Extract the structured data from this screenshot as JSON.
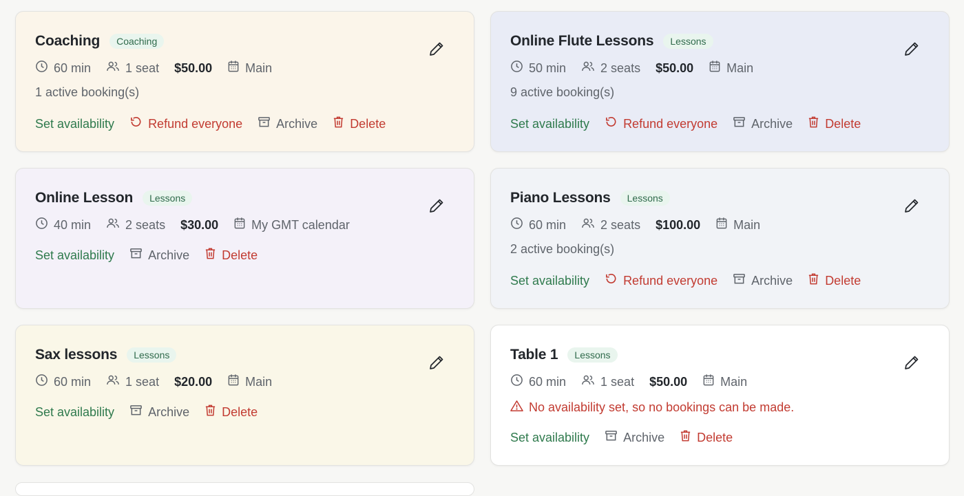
{
  "colors": {
    "page_bg": "#f7f7f5",
    "accent_green": "#2f7a4d",
    "danger_red": "#c23b31",
    "muted": "#5f646b"
  },
  "cards": [
    {
      "title": "Coaching",
      "badge": "Coaching",
      "bg": "#fbf5ea",
      "duration": "60 min",
      "seats": "1 seat",
      "price": "$50.00",
      "calendar": "Main",
      "status": "1 active booking(s)",
      "actions": {
        "availability": "Set availability",
        "refund": "Refund everyone",
        "archive": "Archive",
        "delete": "Delete"
      }
    },
    {
      "title": "Online Flute Lessons",
      "badge": "Lessons",
      "bg": "#e9ecf6",
      "duration": "50 min",
      "seats": "2 seats",
      "price": "$50.00",
      "calendar": "Main",
      "status": "9 active booking(s)",
      "actions": {
        "availability": "Set availability",
        "refund": "Refund everyone",
        "archive": "Archive",
        "delete": "Delete"
      }
    },
    {
      "title": "Online Lesson",
      "badge": "Lessons",
      "bg": "#f4f1f9",
      "duration": "40 min",
      "seats": "2 seats",
      "price": "$30.00",
      "calendar": "My GMT calendar",
      "actions": {
        "availability": "Set availability",
        "archive": "Archive",
        "delete": "Delete"
      }
    },
    {
      "title": "Piano Lessons",
      "badge": "Lessons",
      "bg": "#f1f3f7",
      "duration": "60 min",
      "seats": "2 seats",
      "price": "$100.00",
      "calendar": "Main",
      "status": "2 active booking(s)",
      "actions": {
        "availability": "Set availability",
        "refund": "Refund everyone",
        "archive": "Archive",
        "delete": "Delete"
      }
    },
    {
      "title": "Sax lessons",
      "badge": "Lessons",
      "bg": "#faf7e8",
      "duration": "60 min",
      "seats": "1 seat",
      "price": "$20.00",
      "calendar": "Main",
      "actions": {
        "availability": "Set availability",
        "archive": "Archive",
        "delete": "Delete"
      }
    },
    {
      "title": "Table 1",
      "badge": "Lessons",
      "bg": "#ffffff",
      "duration": "60 min",
      "seats": "1 seat",
      "price": "$50.00",
      "calendar": "Main",
      "warning": "No availability set, so no bookings can be made.",
      "actions": {
        "availability": "Set availability",
        "archive": "Archive",
        "delete": "Delete"
      }
    }
  ]
}
